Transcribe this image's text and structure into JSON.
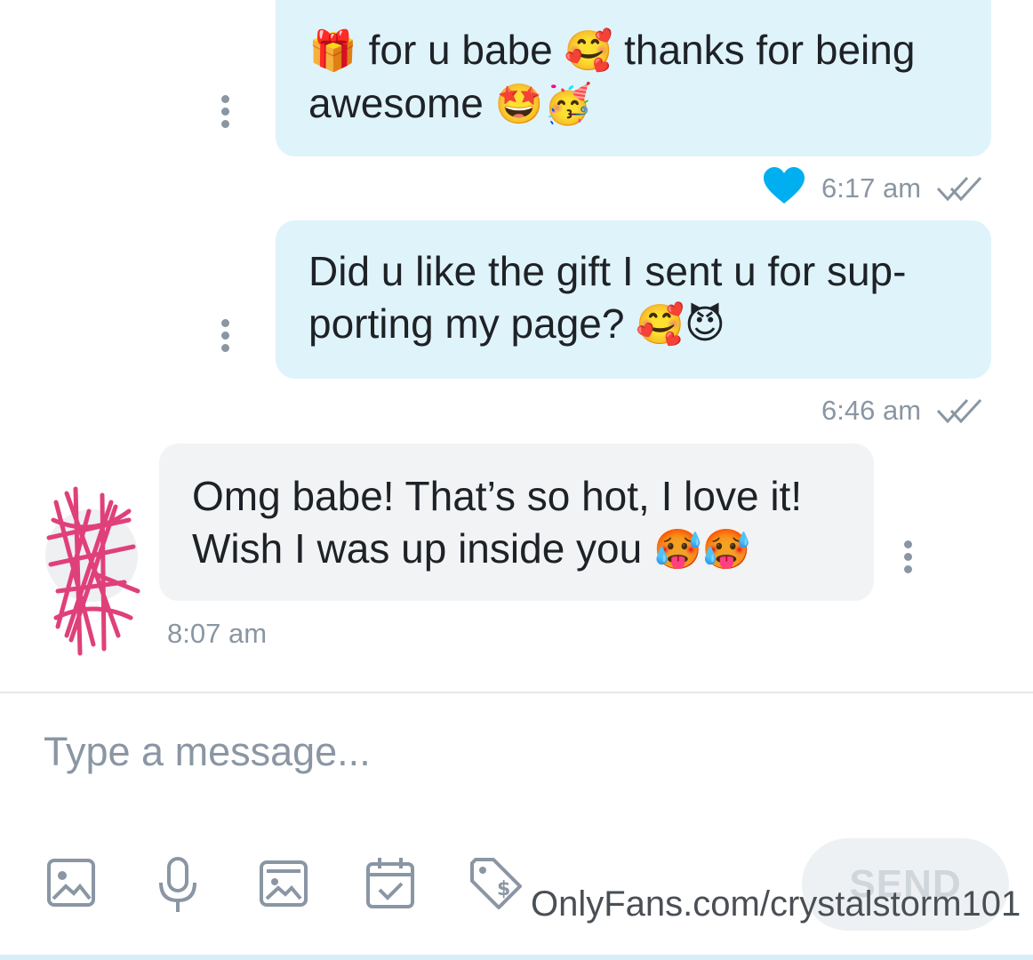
{
  "messages": [
    {
      "direction": "outgoing",
      "text_parts": [
        "🎁",
        " for u babe ",
        "🥰",
        " thanks for being",
        "awesome ",
        "🤩🥳"
      ],
      "time": "6:17 am",
      "liked": true,
      "read": true
    },
    {
      "direction": "outgoing",
      "text_line1": "Did u like the gift I sent u for sup-",
      "text_line2": "porting my page? ",
      "emoji": "🥰😈",
      "time": "6:46 am",
      "read": true
    },
    {
      "direction": "incoming",
      "text_line1": "Omg babe! That’s so hot, I love it!",
      "text_line2": "Wish I was up inside you ",
      "emoji": "🥵🥵",
      "time": "8:07 am"
    }
  ],
  "composer": {
    "placeholder": "Type a message...",
    "send_label": "SEND",
    "tools": [
      "image-icon",
      "microphone-icon",
      "media-vault-icon",
      "calendar-check-icon",
      "price-tag-icon"
    ]
  },
  "watermark": "OnlyFans.com/crystalstorm101",
  "colors": {
    "outgoing_bubble": "#dff3fb",
    "incoming_bubble": "#f1f3f4",
    "like_heart": "#00aff0",
    "muted": "#8a96a3"
  }
}
